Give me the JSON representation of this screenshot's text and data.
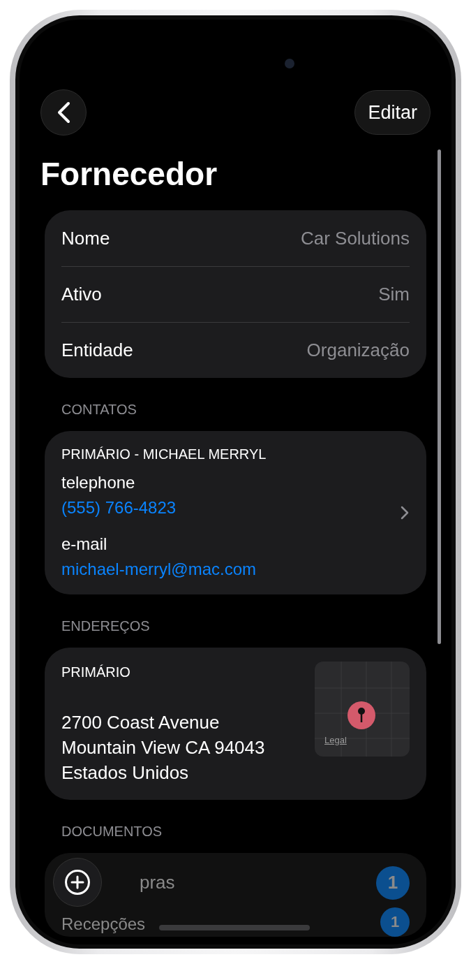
{
  "nav": {
    "edit_label": "Editar"
  },
  "title": "Fornecedor",
  "details": [
    {
      "label": "Nome",
      "value": "Car Solutions"
    },
    {
      "label": "Ativo",
      "value": "Sim"
    },
    {
      "label": "Entidade",
      "value": "Organização"
    }
  ],
  "contacts": {
    "header": "CONTATOS",
    "heading": "PRIMÁRIO - MICHAEL MERRYL",
    "fields": [
      {
        "label": "telephone",
        "value": "(555) 766-4823"
      },
      {
        "label": "e-mail",
        "value": "michael-merryl@mac.com"
      }
    ]
  },
  "addresses": {
    "header": "ENDEREÇOS",
    "heading": "PRIMÁRIO",
    "lines": [
      "2700 Coast Avenue",
      "Mountain View CA 94043",
      "Estados Unidos"
    ],
    "map_legal": "Legal"
  },
  "documents": {
    "header": "DOCUMENTOS",
    "rows": [
      {
        "label": "pras",
        "count": "1"
      },
      {
        "label": "Recepções",
        "count": "1"
      }
    ]
  }
}
